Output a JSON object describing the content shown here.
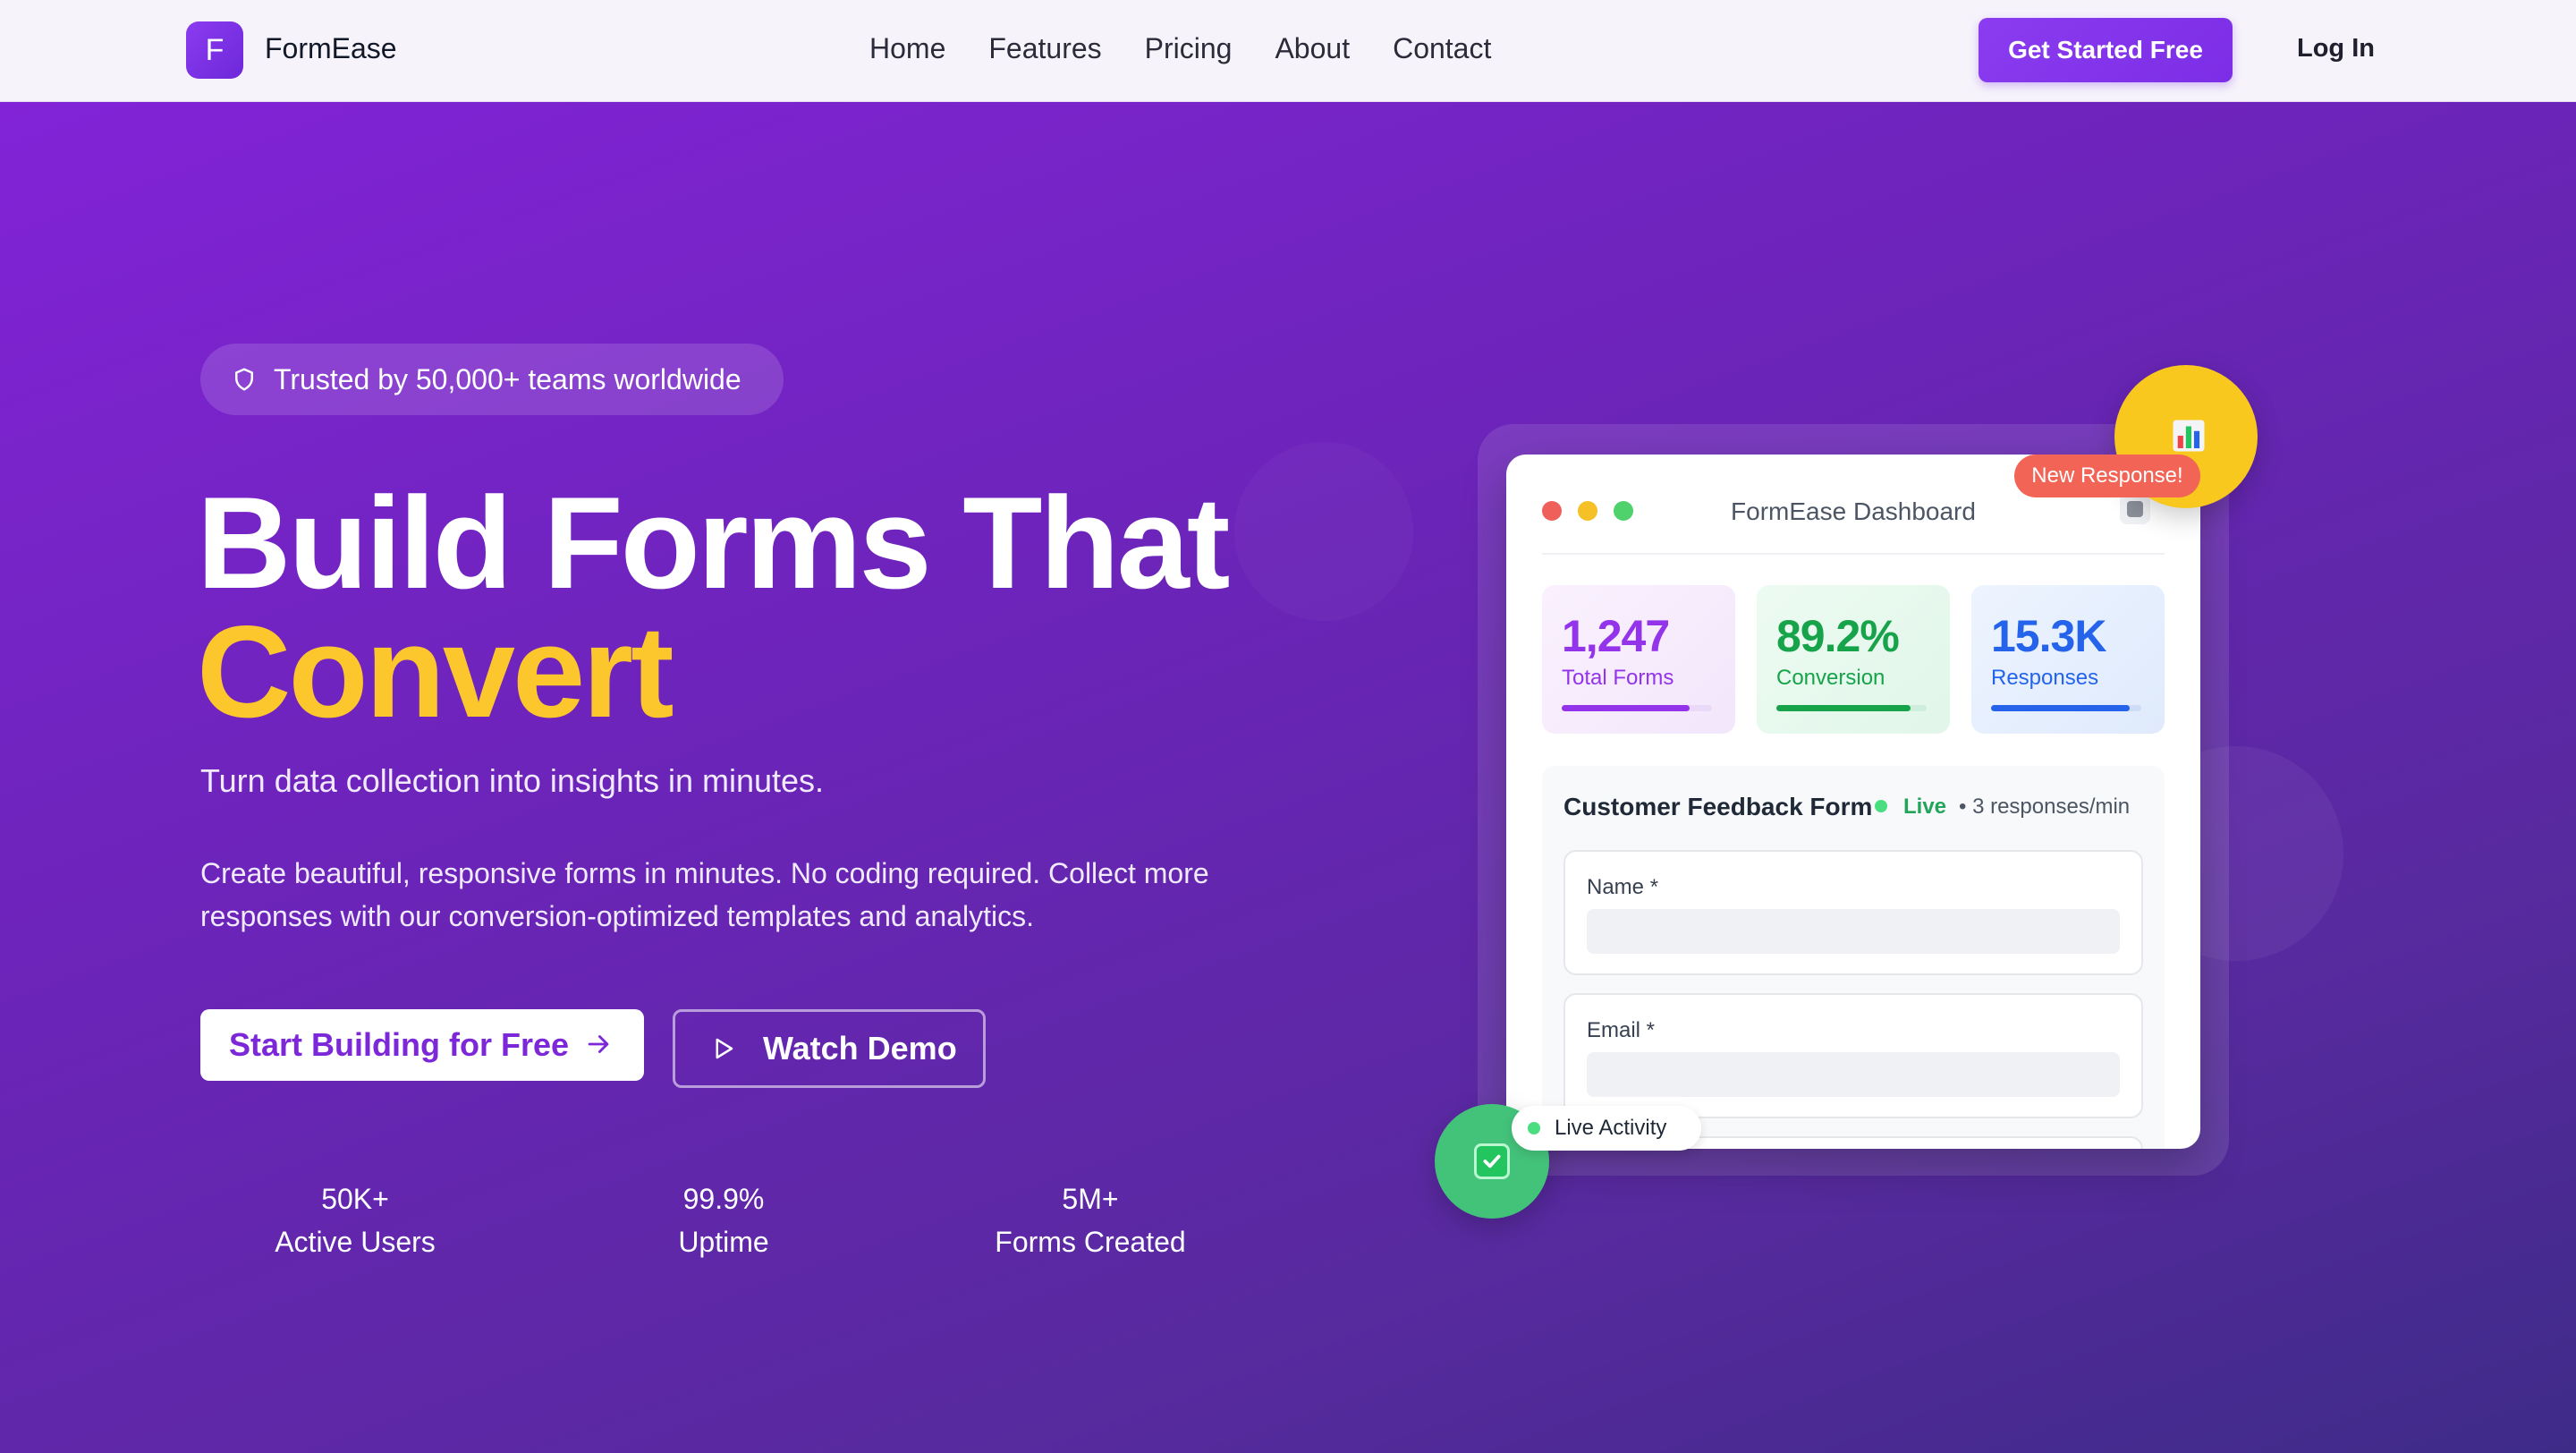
{
  "brand": {
    "logo_letter": "F",
    "name": "FormEase"
  },
  "nav": {
    "links": [
      "Home",
      "Features",
      "Pricing",
      "About",
      "Contact"
    ],
    "cta_label": "Get Started Free",
    "login_label": "Log In"
  },
  "hero": {
    "badge": {
      "icon": "shield-icon",
      "text": "Trusted by 50,000+ teams worldwide"
    },
    "headline_line1": "Build Forms That",
    "headline_line2": "Convert",
    "subheadline": "Turn data collection into insights in minutes.",
    "description": "Create beautiful, responsive forms in minutes. No coding required. Collect more responses with our conversion-optimized templates and analytics.",
    "primary_button": {
      "label": "Start Building for Free",
      "icon": "arrow-right-icon"
    },
    "secondary_button": {
      "label": "Watch Demo",
      "icon": "play-icon"
    },
    "stats": [
      {
        "value": "50K+",
        "label": "Active Users"
      },
      {
        "value": "99.9%",
        "label": "Uptime"
      },
      {
        "value": "5M+",
        "label": "Forms Created"
      }
    ]
  },
  "dashboard": {
    "title": "FormEase Dashboard",
    "metrics": [
      {
        "value": "1,247",
        "label": "Total Forms",
        "progress": 0.85,
        "color": "#9333ea"
      },
      {
        "value": "89.2%",
        "label": "Conversion",
        "progress": 0.89,
        "color": "#16a34a"
      },
      {
        "value": "15.3K",
        "label": "Responses",
        "progress": 0.92,
        "color": "#2563eb"
      }
    ],
    "form": {
      "title": "Customer Feedback Form",
      "status": "Live",
      "rate": "• 3 responses/min",
      "fields": [
        {
          "label": "Name *"
        },
        {
          "label": "Email *"
        }
      ]
    },
    "notification": "New Response!",
    "live_activity": "Live Activity",
    "float_icons": [
      "chart-icon",
      "check-icon"
    ]
  },
  "colors": {
    "accent": "#7c3aed",
    "highlight": "#fcc72c",
    "live": "#4ade80"
  }
}
